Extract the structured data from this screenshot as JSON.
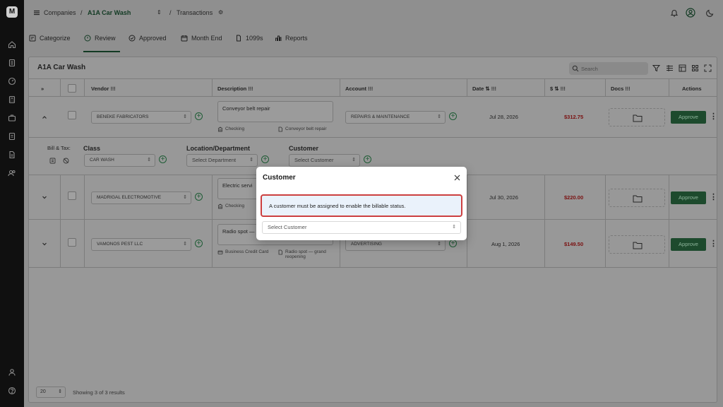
{
  "colors": {
    "sidebar": "#101010",
    "brand_green": "#1d4a2d",
    "amount_red": "#7a1010",
    "alert_border": "#cc3f3f",
    "alert_bg": "#eaf2fb"
  },
  "icons": {
    "sidebar": [
      "home-icon",
      "building-icon",
      "gauge-icon",
      "calculator-icon",
      "briefcase-icon",
      "document-icon",
      "file-text-icon",
      "users-icon",
      "user-icon",
      "help-icon"
    ],
    "topbar": [
      "bell-icon",
      "profile-icon",
      "moon-icon"
    ],
    "toolbar": [
      "filter-icon",
      "columns-icon",
      "table-icon",
      "grid-icon",
      "fullscreen-icon"
    ]
  },
  "brand": {
    "logo_letter": "M"
  },
  "topbar": {
    "companies_label": "Companies",
    "sep1": "/",
    "company_name": "A1A Car Wash",
    "sep2": "/",
    "page": "Transactions"
  },
  "tabs": [
    {
      "label": "Categorize"
    },
    {
      "label": "Review"
    },
    {
      "label": "Approved"
    },
    {
      "label": "Month End"
    },
    {
      "label": "1099s"
    },
    {
      "label": "Reports"
    }
  ],
  "table": {
    "title": "A1A Car Wash",
    "search_placeholder": "Search",
    "expand_all": "»",
    "columns": {
      "vendor": "Vendor ⁝⁝⁝",
      "description": "Description ⁝⁝⁝",
      "account": "Account ⁝⁝⁝",
      "date": "Date ⇅ ⁝⁝⁝",
      "amount": "$ ⇅ ⁝⁝⁝",
      "docs": "Docs ⁝⁝⁝",
      "actions": "Actions"
    },
    "rows": [
      {
        "vendor": "BENEKE FABRICATORS",
        "description": "Conveyor belt repair",
        "payment": "Checking",
        "memo": "Conveyor belt repair",
        "account": "REPAIRS & MAINTENANCE",
        "date": "Jul 28, 2026",
        "amount": "$312.75",
        "action": "Approve"
      },
      {
        "vendor": "MADRIGAL ELECTROMOTIVE",
        "description": "Electric servi",
        "payment": "Checking",
        "memo": "",
        "account": "",
        "date": "Jul 30, 2026",
        "amount": "$220.00",
        "action": "Approve"
      },
      {
        "vendor": "VAMONOS PEST LLC",
        "description": "Radio spot —",
        "payment": "Business Credit Card",
        "memo": "Radio spot — grand reopening",
        "account": "ADVERTISING",
        "date": "Aug 1, 2026",
        "amount": "$149.50",
        "action": "Approve"
      }
    ],
    "expanded": {
      "bill_tax_label": "Bill & Tax:",
      "class_label": "Class",
      "class_value": "CAR WASH",
      "location_label": "Location/Department",
      "location_placeholder": "Select Department",
      "customer_label": "Customer",
      "customer_placeholder": "Select Customer"
    },
    "footer": {
      "page_size": "20",
      "showing": "Showing 3 of 3 results"
    }
  },
  "modal": {
    "title": "Customer",
    "message": "A customer must be assigned to enable the billable status.",
    "select_placeholder": "Select Customer"
  }
}
